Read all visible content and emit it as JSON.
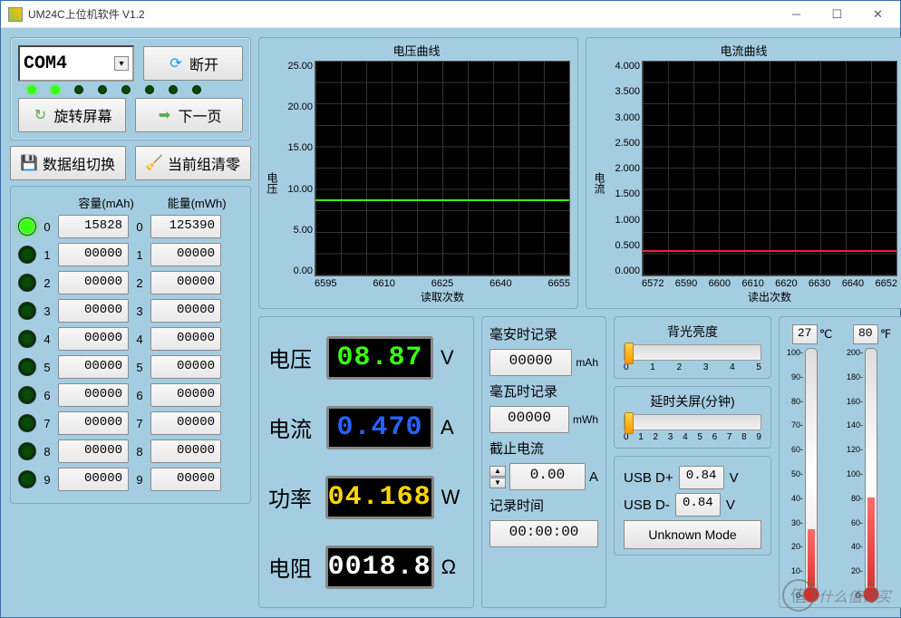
{
  "window": {
    "title": "UM24C上位机软件 V1.2"
  },
  "connection": {
    "port": "COM4",
    "disconnect_label": "断开"
  },
  "nav": {
    "rotate_label": "旋转屏幕",
    "next_label": "下一页",
    "datagroup_switch_label": "数据组切换",
    "current_clear_label": "当前组清零"
  },
  "datagroups": {
    "capacity_header": "容量(mAh)",
    "energy_header": "能量(mWh)",
    "rows": [
      {
        "idx": "0",
        "cap": "15828",
        "eng": "125390",
        "active": true
      },
      {
        "idx": "1",
        "cap": "00000",
        "eng": "00000",
        "active": false
      },
      {
        "idx": "2",
        "cap": "00000",
        "eng": "00000",
        "active": false
      },
      {
        "idx": "3",
        "cap": "00000",
        "eng": "00000",
        "active": false
      },
      {
        "idx": "4",
        "cap": "00000",
        "eng": "00000",
        "active": false
      },
      {
        "idx": "5",
        "cap": "00000",
        "eng": "00000",
        "active": false
      },
      {
        "idx": "6",
        "cap": "00000",
        "eng": "00000",
        "active": false
      },
      {
        "idx": "7",
        "cap": "00000",
        "eng": "00000",
        "active": false
      },
      {
        "idx": "8",
        "cap": "00000",
        "eng": "00000",
        "active": false
      },
      {
        "idx": "9",
        "cap": "00000",
        "eng": "00000",
        "active": false
      }
    ]
  },
  "meters": {
    "voltage": {
      "label": "电压",
      "value": "08.87",
      "unit": "V",
      "color": "#39ff14"
    },
    "current": {
      "label": "电流",
      "value": "0.470",
      "unit": "A",
      "color": "#2962ff"
    },
    "power": {
      "label": "功率",
      "value": "04.168",
      "unit": "W",
      "color": "#ffd600"
    },
    "resist": {
      "label": "电阻",
      "value": "0018.8",
      "unit": "Ω",
      "color": "#ffffff"
    }
  },
  "records": {
    "mah_label": "毫安时记录",
    "mah_value": "00000",
    "mah_unit": "mAh",
    "mwh_label": "毫瓦时记录",
    "mwh_value": "00000",
    "mwh_unit": "mWh",
    "cutoff_label": "截止电流",
    "cutoff_value": "0.00",
    "cutoff_unit": "A",
    "time_label": "记录时间",
    "time_value": "00:00:00"
  },
  "sliders": {
    "backlight_label": "背光亮度",
    "backlight_ticks": [
      "0",
      "1",
      "2",
      "3",
      "4",
      "5"
    ],
    "backlight_pos": 0,
    "screenoff_label": "延时关屏(分钟)",
    "screenoff_ticks": [
      "0",
      "1",
      "2",
      "3",
      "4",
      "5",
      "6",
      "7",
      "8",
      "9"
    ],
    "screenoff_pos": 0
  },
  "usb": {
    "dp_label": "USB D+",
    "dp_value": "0.84",
    "dm_label": "USB D-",
    "dm_value": "0.84",
    "unit": "V",
    "mode_label": "Unknown Mode"
  },
  "temps": {
    "c_value": "27",
    "c_unit": "℃",
    "c_ticks": [
      "100",
      "90",
      "80",
      "70",
      "60",
      "50",
      "40",
      "30",
      "20",
      "10",
      "0"
    ],
    "c_fill_pct": 27,
    "f_value": "80",
    "f_unit": "℉",
    "f_ticks": [
      "200",
      "180",
      "160",
      "140",
      "120",
      "100",
      "80",
      "60",
      "40",
      "20",
      "0"
    ],
    "f_fill_pct": 40
  },
  "watermark": {
    "text": "什么值得买",
    "badge": "值"
  },
  "chart_data": [
    {
      "type": "line",
      "title": "电压曲线",
      "ylabel": "电压",
      "xlabel": "读取次数",
      "ylim": [
        0,
        25
      ],
      "xlim": [
        6595,
        6655
      ],
      "yticks": [
        "25.00",
        "20.00",
        "15.00",
        "10.00",
        "5.00",
        "0.00"
      ],
      "xticks": [
        "6595",
        "6610",
        "6625",
        "6640",
        "6655"
      ],
      "series": [
        {
          "name": "voltage",
          "color": "#39ff14",
          "approx_y": 8.87
        }
      ]
    },
    {
      "type": "line",
      "title": "电流曲线",
      "ylabel": "电流",
      "xlabel": "读出次数",
      "ylim": [
        0,
        4
      ],
      "xlim": [
        6572,
        6652
      ],
      "yticks": [
        "4.000",
        "3.500",
        "3.000",
        "2.500",
        "2.000",
        "1.500",
        "1.000",
        "0.500",
        "0.000"
      ],
      "xticks": [
        "6572",
        "6590",
        "6600",
        "6610",
        "6620",
        "6630",
        "6640",
        "6652"
      ],
      "series": [
        {
          "name": "current",
          "color": "#ff1744",
          "approx_y": 0.47
        }
      ]
    }
  ]
}
